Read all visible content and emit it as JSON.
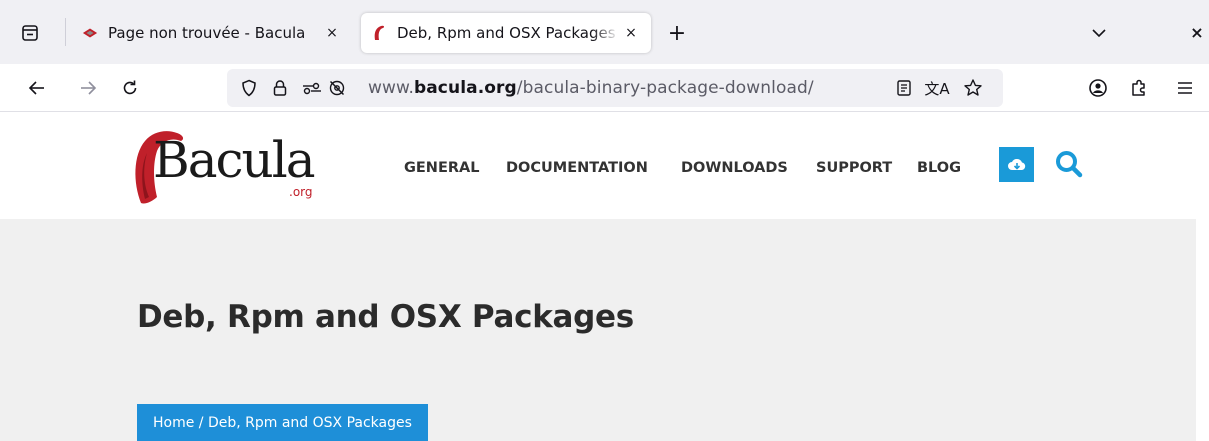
{
  "browser": {
    "tabs": [
      {
        "title": "Page non trouvée - Bacula",
        "favicon": "bacula-ship-icon",
        "active": false
      },
      {
        "title": "Deb, Rpm and OSX Packages",
        "favicon": "bacula-logo-icon",
        "active": true
      }
    ],
    "close_glyph": "×",
    "new_tab_glyph": "+",
    "window_close_glyph": "×",
    "url": {
      "scheme_prefix": "www.",
      "host": "bacula.org",
      "path": "/bacula-binary-package-download/"
    },
    "translate_glyph": "文A"
  },
  "site": {
    "logo_text": "Bacula",
    "logo_suffix": ".org",
    "nav": [
      "GENERAL",
      "DOCUMENTATION",
      "DOWNLOADS",
      "SUPPORT",
      "BLOG"
    ],
    "accent_color": "#1a9ad8"
  },
  "hero": {
    "title": "Deb, Rpm and OSX Packages",
    "breadcrumb": {
      "home": "Home",
      "separator": " / ",
      "current": "Deb, Rpm and OSX Packages"
    },
    "background": "#f0f0f0",
    "breadcrumb_color": "#1e8fd8"
  }
}
